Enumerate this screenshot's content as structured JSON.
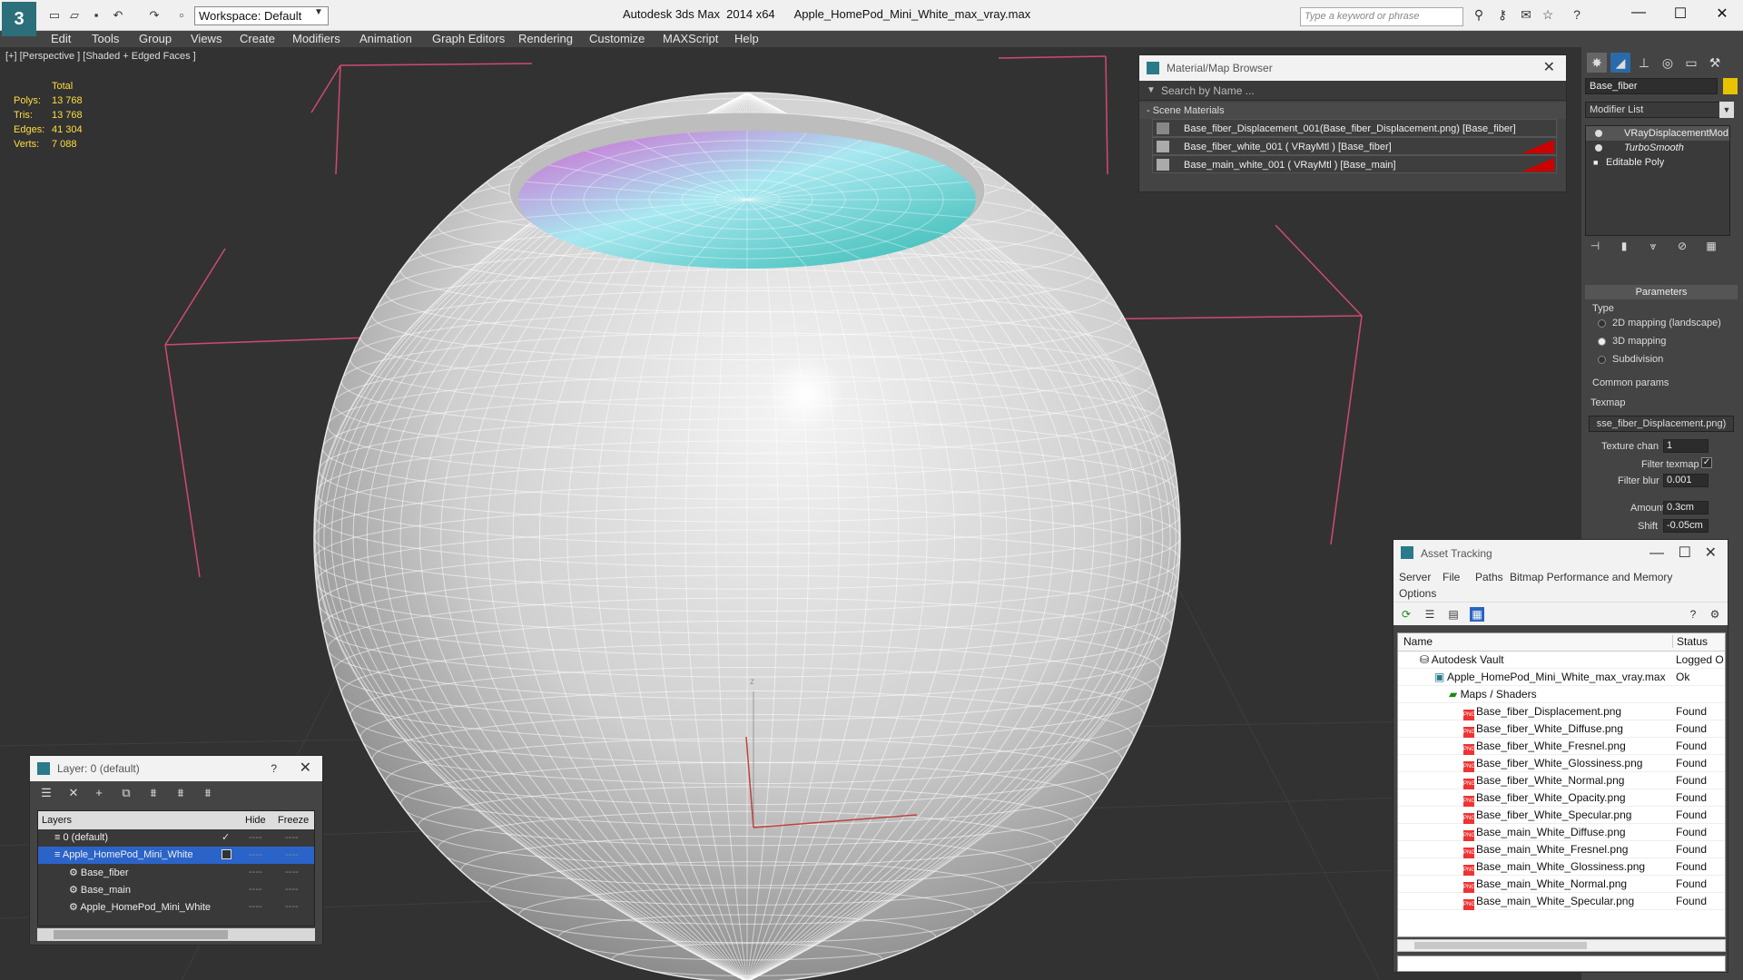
{
  "app": {
    "title": "Autodesk 3ds Max  2014 x64      Apple_HomePod_Mini_White_max_vray.max",
    "workspace": "Workspace: Default",
    "search_placeholder": "Type a keyword or phrase"
  },
  "menu": [
    "Edit",
    "Tools",
    "Group",
    "Views",
    "Create",
    "Modifiers",
    "Animation",
    "Graph Editors",
    "Rendering",
    "Customize",
    "MAXScript",
    "Help"
  ],
  "viewport": {
    "label": "[+] [Perspective ] [Shaded + Edged Faces ]",
    "stats": {
      "header": "Total",
      "rows": [
        {
          "label": "Polys:",
          "value": "13 768"
        },
        {
          "label": "Tris:",
          "value": "13 768"
        },
        {
          "label": "Edges:",
          "value": "41 304"
        },
        {
          "label": "Verts:",
          "value": "7 088"
        }
      ]
    },
    "axis_label": "z"
  },
  "material_browser": {
    "title": "Material/Map Browser",
    "search_placeholder": "Search by Name ...",
    "group": "- Scene Materials",
    "items": [
      "Base_fiber_Displacement_001(Base_fiber_Displacement.png) [Base_fiber]",
      "Base_fiber_white_001  ( VRayMtl ) [Base_fiber]",
      "Base_main_white_001  ( VRayMtl ) [Base_main]"
    ]
  },
  "command_panel": {
    "object_name": "Base_fiber",
    "object_color": "#e8c400",
    "modifier_list": "Modifier List",
    "stack": [
      "VRayDisplacementMod",
      "TurboSmooth",
      "Editable Poly"
    ],
    "parameters_header": "Parameters",
    "type_label": "Type",
    "type_options": [
      "2D mapping (landscape)",
      "3D mapping",
      "Subdivision"
    ],
    "common_label": "Common params",
    "texmap_label": "Texmap",
    "texmap_value": "sse_fiber_Displacement.png)",
    "texture_chan_label": "Texture chan",
    "texture_chan_value": "1",
    "filter_texmap_label": "Filter texmap",
    "filter_blur_label": "Filter blur",
    "filter_blur_value": "0.001",
    "amount_label": "Amount",
    "amount_value": "0.3cm",
    "shift_label": "Shift",
    "shift_value": "-0.05cm"
  },
  "asset_tracking": {
    "title": "Asset Tracking",
    "menu": [
      "Server",
      "File",
      "Paths",
      "Bitmap Performance and Memory",
      "Options"
    ],
    "columns": [
      "Name",
      "Status"
    ],
    "vault": {
      "name": "Autodesk Vault",
      "status": "Logged O"
    },
    "file": {
      "name": "Apple_HomePod_Mini_White_max_vray.max",
      "status": "Ok"
    },
    "folder": "Maps / Shaders",
    "maps": [
      {
        "name": "Base_fiber_Displacement.png",
        "status": "Found"
      },
      {
        "name": "Base_fiber_White_Diffuse.png",
        "status": "Found"
      },
      {
        "name": "Base_fiber_White_Fresnel.png",
        "status": "Found"
      },
      {
        "name": "Base_fiber_White_Glossiness.png",
        "status": "Found"
      },
      {
        "name": "Base_fiber_White_Normal.png",
        "status": "Found"
      },
      {
        "name": "Base_fiber_White_Opacity.png",
        "status": "Found"
      },
      {
        "name": "Base_fiber_White_Specular.png",
        "status": "Found"
      },
      {
        "name": "Base_main_White_Diffuse.png",
        "status": "Found"
      },
      {
        "name": "Base_main_White_Fresnel.png",
        "status": "Found"
      },
      {
        "name": "Base_main_White_Glossiness.png",
        "status": "Found"
      },
      {
        "name": "Base_main_White_Normal.png",
        "status": "Found"
      },
      {
        "name": "Base_main_White_Specular.png",
        "status": "Found"
      }
    ],
    "png_badge": "PNG"
  },
  "layers": {
    "title": "Layer: 0 (default)",
    "help": "?",
    "columns": [
      "Layers",
      "Hide",
      "Freeze"
    ],
    "rows": [
      {
        "name": "0 (default)"
      },
      {
        "name": "Apple_HomePod_Mini_White"
      },
      {
        "name": "Base_fiber"
      },
      {
        "name": "Base_main"
      },
      {
        "name": "Apple_HomePod_Mini_White"
      }
    ],
    "dash": "----"
  }
}
